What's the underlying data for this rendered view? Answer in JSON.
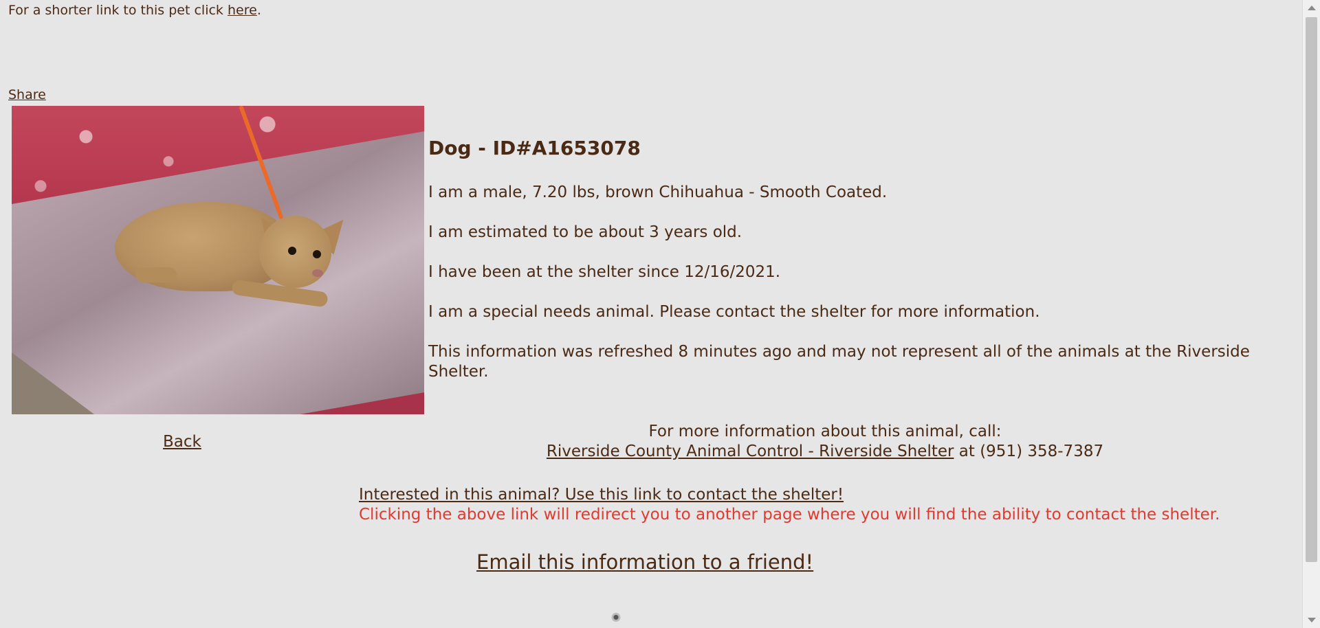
{
  "shortlink": {
    "prefix": "For a shorter link to this pet click ",
    "link": "here",
    "suffix": "."
  },
  "share_label": "Share",
  "photo": {
    "alt": "Photo of dog"
  },
  "pet": {
    "title": "Dog - ID#A1653078",
    "description": "I am a male, 7.20 lbs, brown Chihuahua - Smooth Coated.",
    "age": "I am estimated to be about 3 years old.",
    "since": "I have been at the shelter since 12/16/2021.",
    "special_needs": "I am a special needs animal. Please contact the shelter for more information.",
    "refresh": "This information was refreshed 8 minutes ago and may not represent all of the animals at the Riverside Shelter."
  },
  "back_label": "Back",
  "contact": {
    "line1": "For more information about this animal, call:",
    "shelter_link": "Riverside County Animal Control - Riverside Shelter",
    "at": " at (951) 358-7387"
  },
  "interest": {
    "link": "Interested in this animal? Use this link to contact the shelter!",
    "note": "Clicking the above link will redirect you to another page where you will find the ability to contact the shelter."
  },
  "email_label": "Email this information to a friend!",
  "colors": {
    "background": "#e6e6e6",
    "text": "#4a2a14",
    "warning": "#e03a30"
  }
}
